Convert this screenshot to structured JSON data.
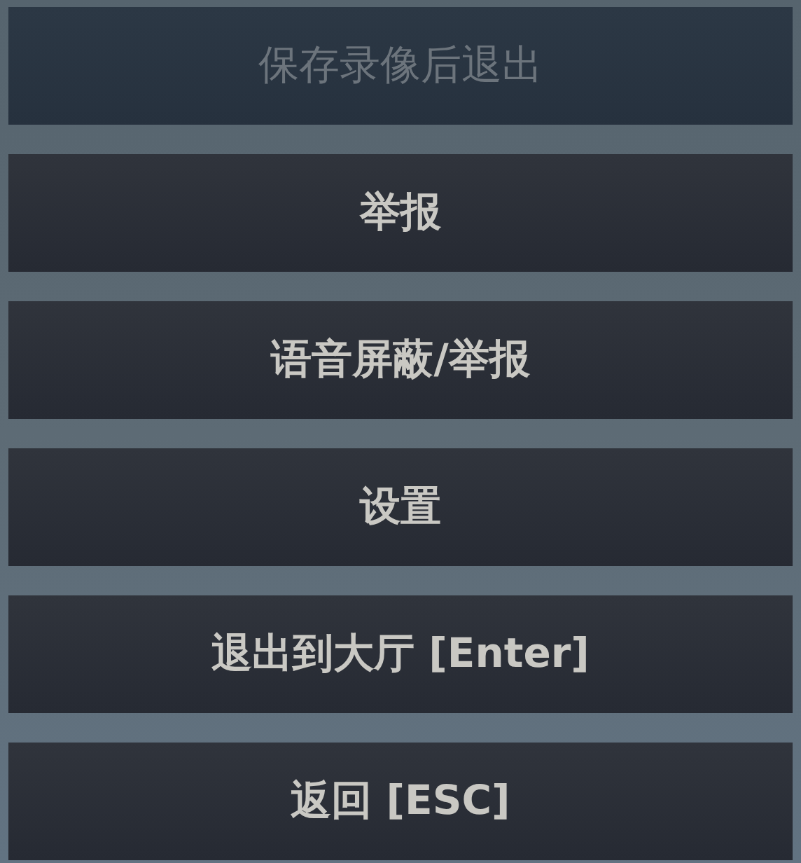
{
  "menu": {
    "buttons": [
      {
        "label": "保存录像后退出",
        "disabled": true
      },
      {
        "label": "举报",
        "disabled": false
      },
      {
        "label": "语音屏蔽/举报",
        "disabled": false
      },
      {
        "label": "设置",
        "disabled": false
      },
      {
        "label": "退出到大厅 [Enter]",
        "disabled": false
      },
      {
        "label": "返回 [ESC]",
        "disabled": false
      }
    ]
  }
}
